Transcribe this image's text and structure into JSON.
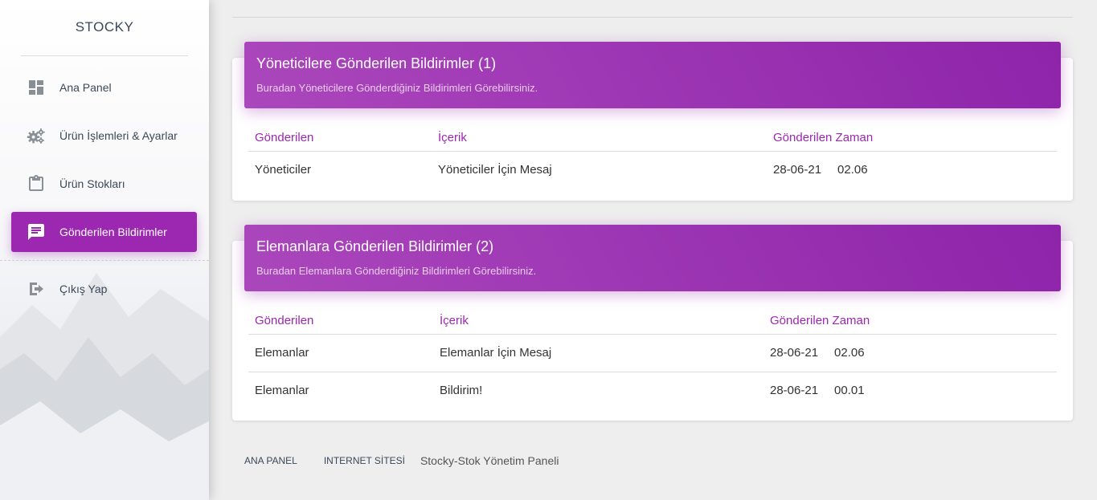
{
  "sidebar": {
    "logo": "STOCKY",
    "items": [
      {
        "label": "Ana Panel",
        "icon": "dashboard-icon",
        "active": false
      },
      {
        "label": "Ürün İşlemleri & Ayarlar",
        "icon": "gears-icon",
        "active": false
      },
      {
        "label": "Ürün Stokları",
        "icon": "clipboard-icon",
        "active": false
      },
      {
        "label": "Gönderilen Bildirimler",
        "icon": "chat-icon",
        "active": true
      }
    ],
    "logout": {
      "label": "Çıkış Yap",
      "icon": "logout-icon"
    }
  },
  "cards": [
    {
      "title": "Yöneticilere Gönderilen Bildirimler (1)",
      "subtitle": "Buradan Yöneticilere Gönderdiğiniz Bildirimleri Görebilirsiniz.",
      "columns": [
        "Gönderilen",
        "İçerik",
        "Gönderilen Zaman"
      ],
      "rows": [
        {
          "sent_to": "Yöneticiler",
          "content": "Yöneticiler İçin Mesaj",
          "date": "28-06-21",
          "time": "02.06"
        }
      ]
    },
    {
      "title": "Elemanlara Gönderilen Bildirimler (2)",
      "subtitle": "Buradan Elemanlara Gönderdiğiniz Bildirimleri Görebilirsiniz.",
      "columns": [
        "Gönderilen",
        "İçerik",
        "Gönderilen Zaman"
      ],
      "rows": [
        {
          "sent_to": "Elemanlar",
          "content": "Elemanlar İçin Mesaj",
          "date": "28-06-21",
          "time": "02.06"
        },
        {
          "sent_to": "Elemanlar",
          "content": "Bildirim!",
          "date": "28-06-21",
          "time": "00.01"
        }
      ]
    }
  ],
  "footer": {
    "links": [
      "ANA PANEL",
      "INTERNET SİTESİ"
    ],
    "text": "Stocky-Stok Yönetim Paneli"
  },
  "colors": {
    "accent": "#9c27b0",
    "background": "#eeeeee"
  }
}
